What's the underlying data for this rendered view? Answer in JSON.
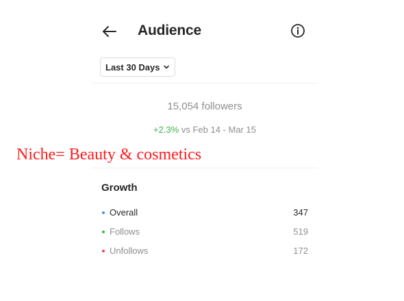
{
  "header": {
    "title": "Audience",
    "back_icon": "arrow-left-icon",
    "info_icon": "info-circle-icon"
  },
  "date_filter": {
    "selected": "Last 30 Days",
    "icon": "chevron-down-icon"
  },
  "summary": {
    "followers": "15,054 followers",
    "change_pct": "+2.3%",
    "change_text": " vs Feb 14 - Mar 15"
  },
  "annotation": {
    "text": "Niche= Beauty & cosmetics",
    "color": "#ff1a1a"
  },
  "growth": {
    "title": "Growth",
    "rows": [
      {
        "label": "Overall",
        "value": "347",
        "color": "#3897f0"
      },
      {
        "label": "Follows",
        "value": "519",
        "color": "#3bb54a"
      },
      {
        "label": "Unfollows",
        "value": "172",
        "color": "#ed4956"
      }
    ]
  },
  "colors": {
    "positive": "#3bb54a",
    "muted_text": "#8e8e8e",
    "primary_text": "#262626"
  }
}
